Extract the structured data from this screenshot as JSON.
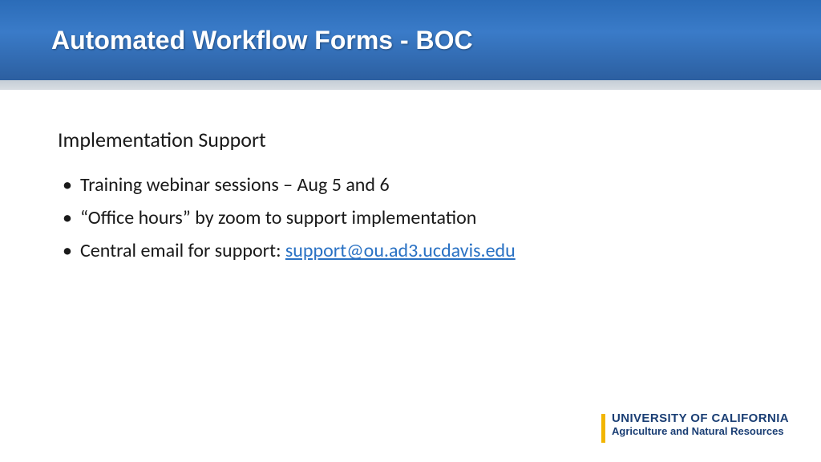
{
  "header": {
    "title": "Automated Workflow Forms - BOC"
  },
  "content": {
    "subtitle": "Implementation Support",
    "bullets": [
      {
        "text": "Training webinar sessions – Aug 5 and 6"
      },
      {
        "text": "“Office hours” by zoom to support implementation"
      },
      {
        "prefix": " Central email for support: ",
        "link": "support@ou.ad3.ucdavis.edu"
      }
    ]
  },
  "footer": {
    "logo_line1": "UNIVERSITY OF CALIFORNIA",
    "logo_line2": "Agriculture and Natural Resources"
  }
}
